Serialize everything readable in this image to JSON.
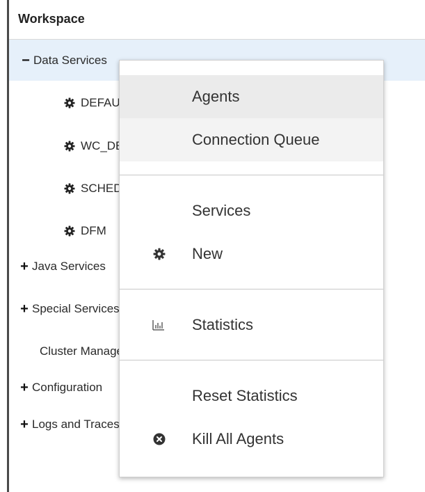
{
  "workspace": {
    "title": "Workspace"
  },
  "tree": {
    "items": [
      {
        "sign": "−",
        "label": "Data Services"
      },
      {
        "label": "DEFAULT"
      },
      {
        "label": "WC_DEFAULT"
      },
      {
        "label": "SCHEDULER"
      },
      {
        "label": "DFM"
      },
      {
        "sign": "+",
        "label": "Java Services"
      },
      {
        "sign": "+",
        "label": "Special Services"
      },
      {
        "label": "Cluster Management"
      },
      {
        "sign": "+",
        "label": "Configuration"
      },
      {
        "sign": "+",
        "label": "Logs and Traces"
      }
    ]
  },
  "context_menu": {
    "agents": "Agents",
    "connection_queue": "Connection Queue",
    "services": "Services",
    "new": "New",
    "statistics": "Statistics",
    "reset_statistics": "Reset Statistics",
    "kill_all_agents": "Kill All Agents"
  },
  "icons": {
    "gear": "gear-icon",
    "bar_chart": "bar-chart-icon",
    "close_circle": "close-circle-icon"
  },
  "colors": {
    "selected_row": "#e6f0fa",
    "menu_hover": "#ebebeb"
  }
}
